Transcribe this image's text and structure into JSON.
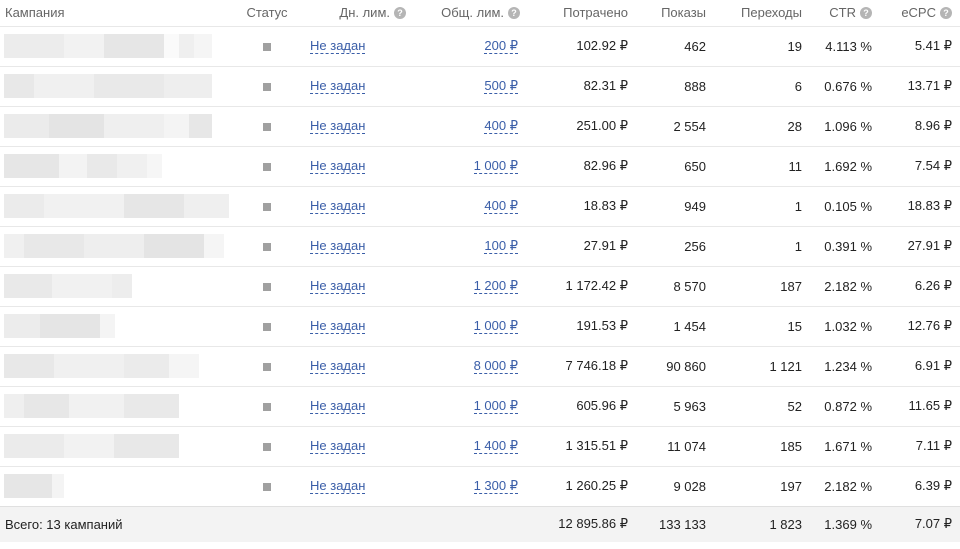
{
  "headers": {
    "campaign": "Кампания",
    "status": "Статус",
    "daily": "Дн. лим.",
    "total": "Общ. лим.",
    "spent": "Потрачено",
    "impressions": "Показы",
    "clicks": "Переходы",
    "ctr": "CTR",
    "ecpc": "eCPC",
    "help_glyph": "?"
  },
  "rows": [
    {
      "daily": "Не задан",
      "total": "200 ₽",
      "spent": "102.92 ₽",
      "impressions": "462",
      "clicks": "19",
      "ctr": "4.113 %",
      "ecpc": "5.41 ₽"
    },
    {
      "daily": "Не задан",
      "total": "500 ₽",
      "spent": "82.31 ₽",
      "impressions": "888",
      "clicks": "6",
      "ctr": "0.676 %",
      "ecpc": "13.71 ₽"
    },
    {
      "daily": "Не задан",
      "total": "400 ₽",
      "spent": "251.00 ₽",
      "impressions": "2 554",
      "clicks": "28",
      "ctr": "1.096 %",
      "ecpc": "8.96 ₽"
    },
    {
      "daily": "Не задан",
      "total": "1 000 ₽",
      "spent": "82.96 ₽",
      "impressions": "650",
      "clicks": "11",
      "ctr": "1.692 %",
      "ecpc": "7.54 ₽"
    },
    {
      "daily": "Не задан",
      "total": "400 ₽",
      "spent": "18.83 ₽",
      "impressions": "949",
      "clicks": "1",
      "ctr": "0.105 %",
      "ecpc": "18.83 ₽"
    },
    {
      "daily": "Не задан",
      "total": "100 ₽",
      "spent": "27.91 ₽",
      "impressions": "256",
      "clicks": "1",
      "ctr": "0.391 %",
      "ecpc": "27.91 ₽"
    },
    {
      "daily": "Не задан",
      "total": "1 200 ₽",
      "spent": "1 172.42 ₽",
      "impressions": "8 570",
      "clicks": "187",
      "ctr": "2.182 %",
      "ecpc": "6.26 ₽"
    },
    {
      "daily": "Не задан",
      "total": "1 000 ₽",
      "spent": "191.53 ₽",
      "impressions": "1 454",
      "clicks": "15",
      "ctr": "1.032 %",
      "ecpc": "12.76 ₽"
    },
    {
      "daily": "Не задан",
      "total": "8 000 ₽",
      "spent": "7 746.18 ₽",
      "impressions": "90 860",
      "clicks": "1 121",
      "ctr": "1.234 %",
      "ecpc": "6.91 ₽"
    },
    {
      "daily": "Не задан",
      "total": "1 000 ₽",
      "spent": "605.96 ₽",
      "impressions": "5 963",
      "clicks": "52",
      "ctr": "0.872 %",
      "ecpc": "11.65 ₽"
    },
    {
      "daily": "Не задан",
      "total": "1 400 ₽",
      "spent": "1 315.51 ₽",
      "impressions": "11 074",
      "clicks": "185",
      "ctr": "1.671 %",
      "ecpc": "7.11 ₽"
    },
    {
      "daily": "Не задан",
      "total": "1 300 ₽",
      "spent": "1 260.25 ₽",
      "impressions": "9 028",
      "clicks": "197",
      "ctr": "2.182 %",
      "ecpc": "6.39 ₽"
    }
  ],
  "totals": {
    "label": "Всего: 13 кампаний",
    "spent": "12 895.86 ₽",
    "impressions": "133 133",
    "clicks": "1 823",
    "ctr": "1.369 %",
    "ecpc": "7.07 ₽"
  },
  "colors": {
    "link": "#3a5ea8",
    "status_square": "#a0a0a0",
    "footer_bg": "#f3f3f3"
  }
}
